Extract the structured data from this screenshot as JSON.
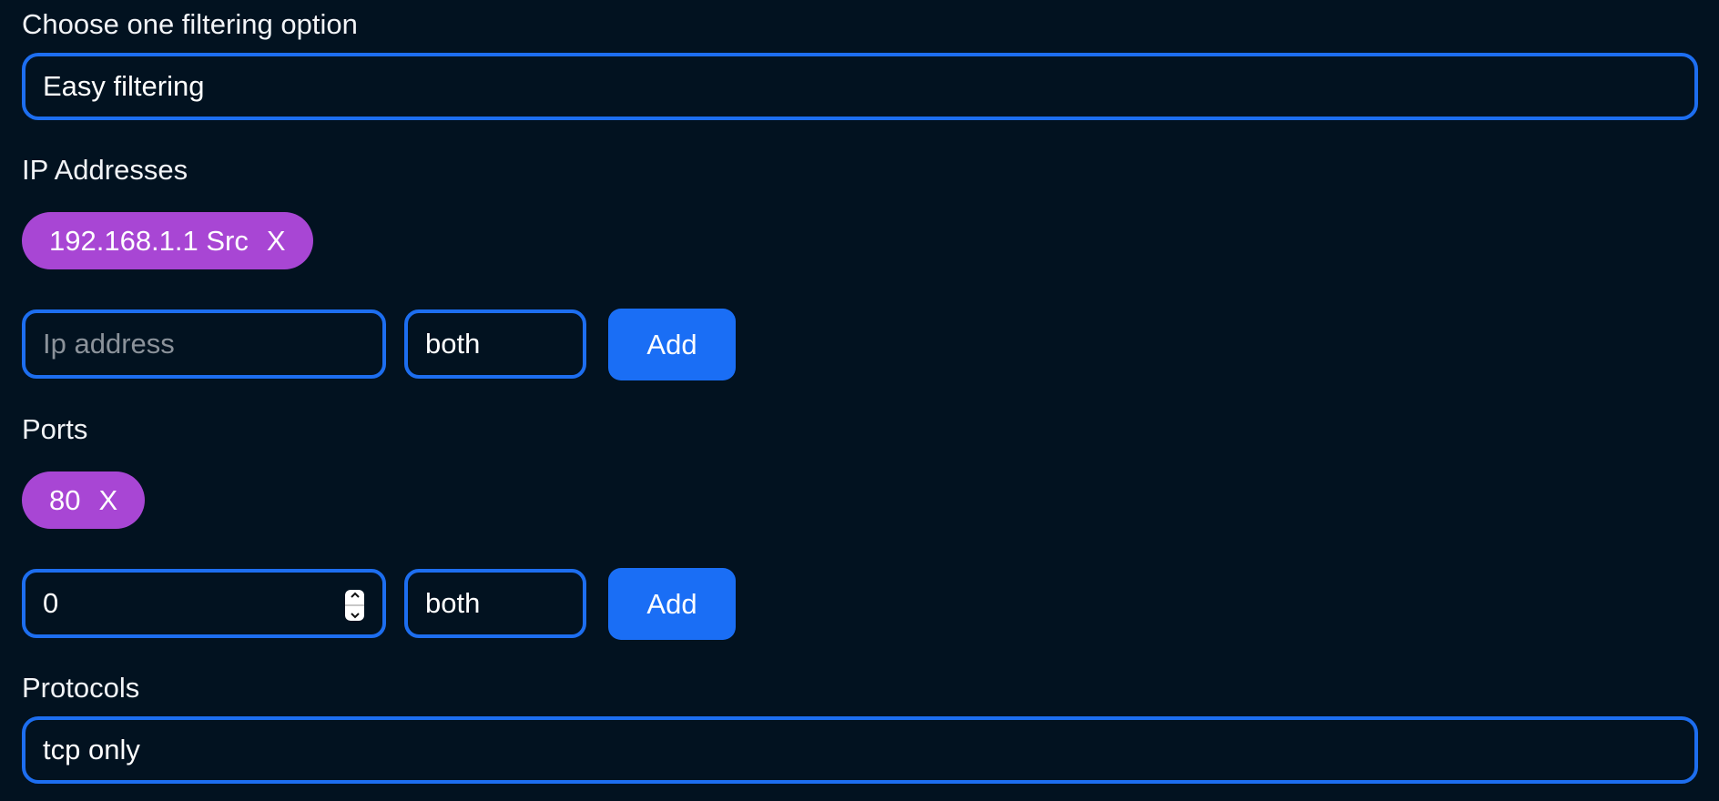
{
  "filtering": {
    "label": "Choose one filtering option",
    "selected": "Easy filtering"
  },
  "ip_addresses": {
    "label": "IP Addresses",
    "chips": [
      {
        "text": "192.168.1.1 Src",
        "remove": "X"
      }
    ],
    "input": {
      "value": "",
      "placeholder": "Ip address"
    },
    "direction": {
      "selected": "both"
    },
    "add_label": "Add"
  },
  "ports": {
    "label": "Ports",
    "chips": [
      {
        "text": "80",
        "remove": "X"
      }
    ],
    "input": {
      "value": "0"
    },
    "direction": {
      "selected": "both"
    },
    "add_label": "Add"
  },
  "protocols": {
    "label": "Protocols",
    "selected": "tcp only"
  },
  "colors": {
    "background": "#021220",
    "accent": "#1a6ef5",
    "chip": "#a846d4"
  }
}
